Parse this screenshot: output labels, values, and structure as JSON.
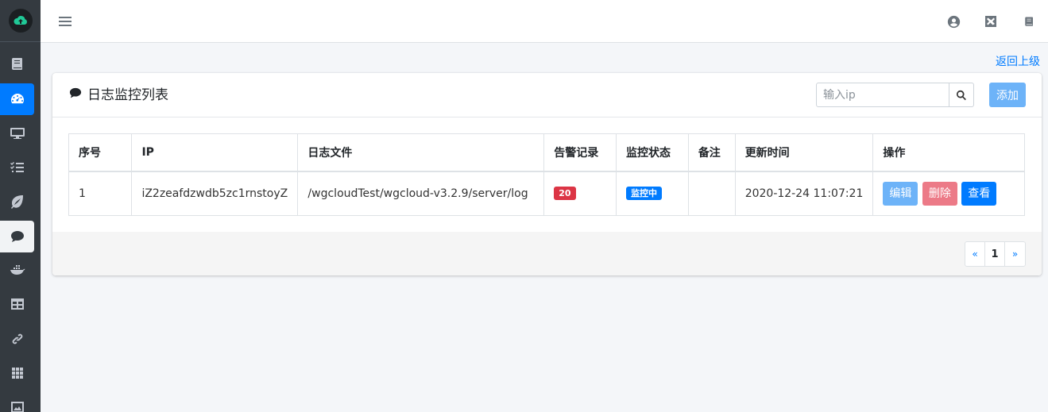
{
  "sidebar": {
    "brand_icon": "cloud-upload-icon",
    "items": [
      {
        "icon": "book-icon"
      },
      {
        "icon": "dashboard-icon",
        "state": "active-blue"
      },
      {
        "icon": "desktop-icon"
      },
      {
        "icon": "tasks-icon"
      },
      {
        "icon": "leaf-icon"
      },
      {
        "icon": "comment-icon",
        "state": "active-light"
      },
      {
        "icon": "docker-icon"
      },
      {
        "icon": "table-icon"
      },
      {
        "icon": "link-icon"
      },
      {
        "icon": "grid-icon"
      },
      {
        "icon": "image-icon"
      }
    ]
  },
  "navbar": {
    "menu_icon": "hamburger-menu-icon",
    "right_icons": [
      "user-circle-icon",
      "close-square-icon",
      "book-icon"
    ]
  },
  "back_link": "返回上级",
  "card": {
    "title": "日志监控列表",
    "search_placeholder": "输入ip",
    "add_label": "添加"
  },
  "table": {
    "headers": [
      "序号",
      "IP",
      "日志文件",
      "告警记录",
      "监控状态",
      "备注",
      "更新时间",
      "操作"
    ],
    "rows": [
      {
        "index": "1",
        "ip": "iZ2zeafdzwdb5zc1rnstoyZ",
        "log_file": "/wgcloudTest/wgcloud-v3.2.9/server/log",
        "alarm_count": "20",
        "status": "监控中",
        "remark": "",
        "updated": "2020-12-24 11:07:21",
        "actions": {
          "edit": "编辑",
          "delete": "删除",
          "view": "查看"
        }
      }
    ]
  },
  "pagination": {
    "prev": "«",
    "current": "1",
    "next": "»"
  },
  "colors": {
    "primary": "#007bff",
    "sidebar_bg": "#343a40",
    "danger": "#dc3545",
    "edit_btn": "#6db3f8",
    "delete_btn": "#ec7a87"
  }
}
